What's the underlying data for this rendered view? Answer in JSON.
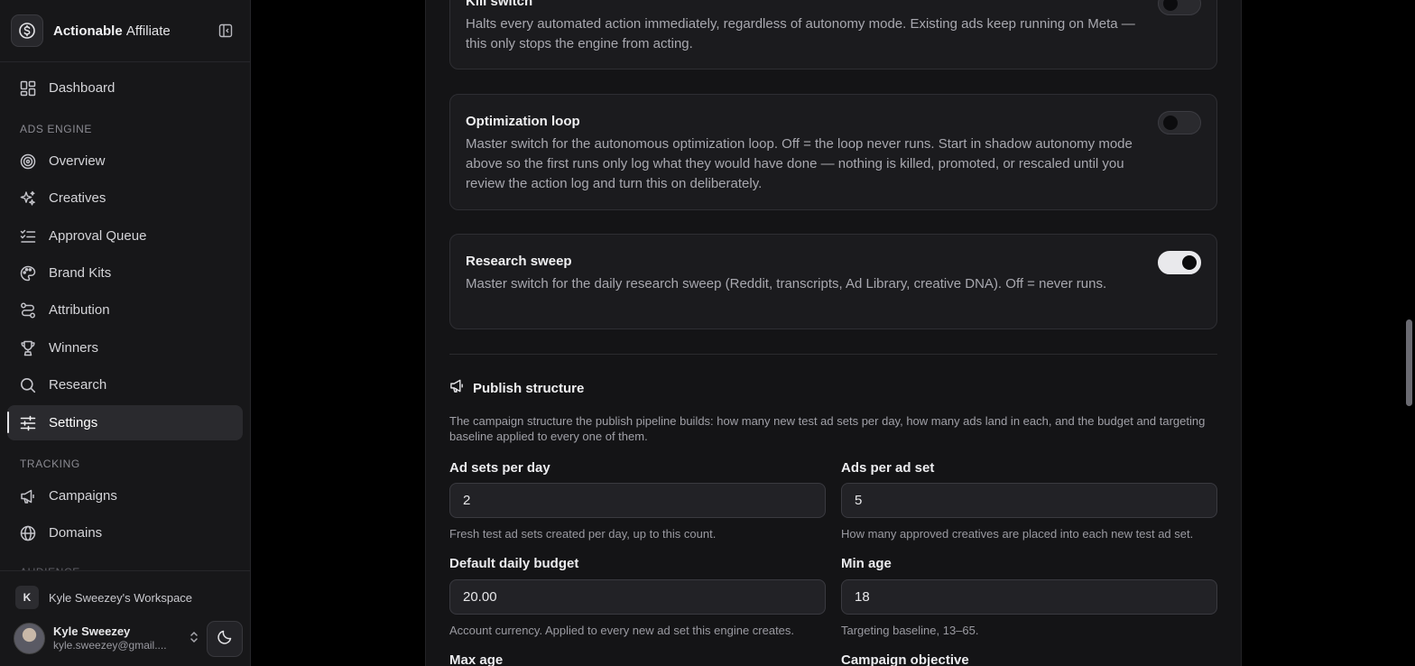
{
  "brand": {
    "name_bold": "Actionable",
    "name_light": "Affiliate"
  },
  "sidebar": {
    "sections": {
      "ads_engine": "ADS ENGINE",
      "tracking": "TRACKING",
      "audience_partial": "AUDIENCE"
    },
    "items": {
      "dashboard": "Dashboard",
      "overview": "Overview",
      "creatives": "Creatives",
      "approval_queue": "Approval Queue",
      "brand_kits": "Brand Kits",
      "attribution": "Attribution",
      "winners": "Winners",
      "research": "Research",
      "settings": "Settings",
      "campaigns": "Campaigns",
      "domains": "Domains"
    },
    "workspace": {
      "badge": "K",
      "name": "Kyle Sweezey's Workspace"
    },
    "user": {
      "name": "Kyle Sweezey",
      "email": "kyle.sweezey@gmail...."
    }
  },
  "switches": {
    "kill": {
      "title": "Kill switch",
      "desc": "Halts every automated action immediately, regardless of autonomy mode. Existing ads keep running on Meta — this only stops the engine from acting.",
      "on": false
    },
    "optimization": {
      "title": "Optimization loop",
      "desc": "Master switch for the autonomous optimization loop. Off = the loop never runs. Start in shadow autonomy mode above so the first runs only log what they would have done — nothing is killed, promoted, or rescaled until you review the action log and turn this on deliberately.",
      "on": false
    },
    "research": {
      "title": "Research sweep",
      "desc": "Master switch for the daily research sweep (Reddit, transcripts, Ad Library, creative DNA). Off = never runs.",
      "on": true
    }
  },
  "publish": {
    "title": "Publish structure",
    "desc": "The campaign structure the publish pipeline builds: how many new test ad sets per day, how many ads land in each, and the budget and targeting baseline applied to every one of them.",
    "fields": {
      "ad_sets_per_day": {
        "label": "Ad sets per day",
        "value": "2",
        "help": "Fresh test ad sets created per day, up to this count."
      },
      "ads_per_ad_set": {
        "label": "Ads per ad set",
        "value": "5",
        "help": "How many approved creatives are placed into each new test ad set."
      },
      "default_daily_budget": {
        "label": "Default daily budget",
        "value": "20.00",
        "help": "Account currency. Applied to every new ad set this engine creates."
      },
      "min_age": {
        "label": "Min age",
        "value": "18",
        "help": "Targeting baseline, 13–65."
      },
      "max_age": {
        "label": "Max age"
      },
      "campaign_objective": {
        "label": "Campaign objective"
      }
    }
  },
  "colors": {
    "accent": "#e9e9ec",
    "bg": "#000000",
    "panel": "#141416",
    "sidebar": "#171719"
  }
}
